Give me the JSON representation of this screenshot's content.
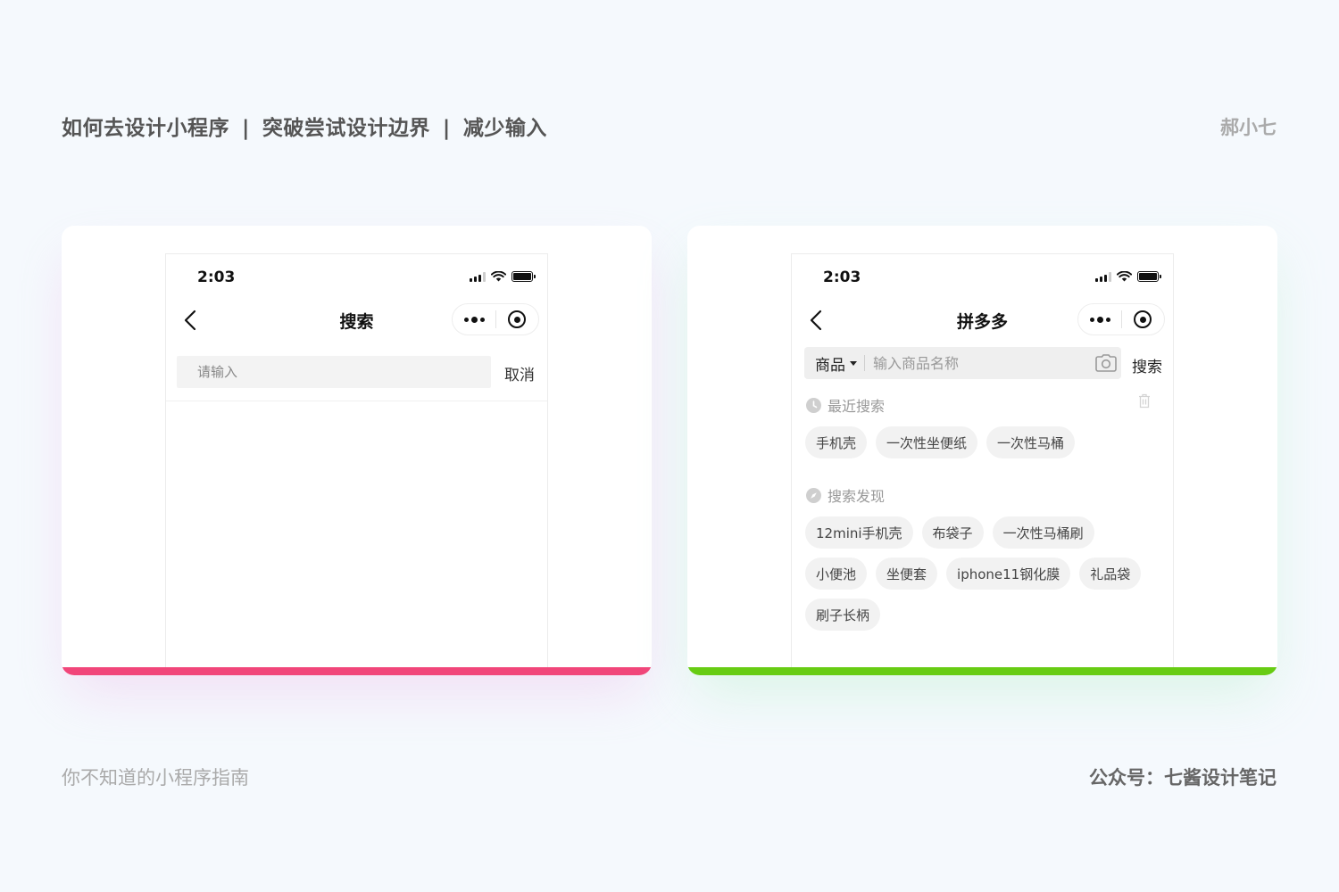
{
  "header": {
    "title_part1": "如何去设计小程序",
    "title_part2": "突破尝试设计边界",
    "title_part3": "减少输入",
    "separator": "|",
    "author": "郝小七"
  },
  "footer": {
    "left": "你不知道的小程序指南",
    "right": "公众号：七酱设计笔记"
  },
  "colors": {
    "left_accent": "#f1467a",
    "right_accent": "#67cc13"
  },
  "left_phone": {
    "time": "2:03",
    "nav_title": "搜索",
    "search_placeholder": "请输入",
    "cancel_label": "取消"
  },
  "right_phone": {
    "time": "2:03",
    "nav_title": "拼多多",
    "category_label": "商品",
    "search_placeholder": "输入商品名称",
    "search_button": "搜索",
    "recent": {
      "title": "最近搜索",
      "chips": [
        "手机壳",
        "一次性坐便纸",
        "一次性马桶"
      ]
    },
    "discover": {
      "title": "搜索发现",
      "chips": [
        "12mini手机壳",
        "布袋子",
        "一次性马桶刷",
        "小便池",
        "坐便套",
        "iphone11钢化膜",
        "礼品袋",
        "刷子长柄"
      ]
    }
  }
}
